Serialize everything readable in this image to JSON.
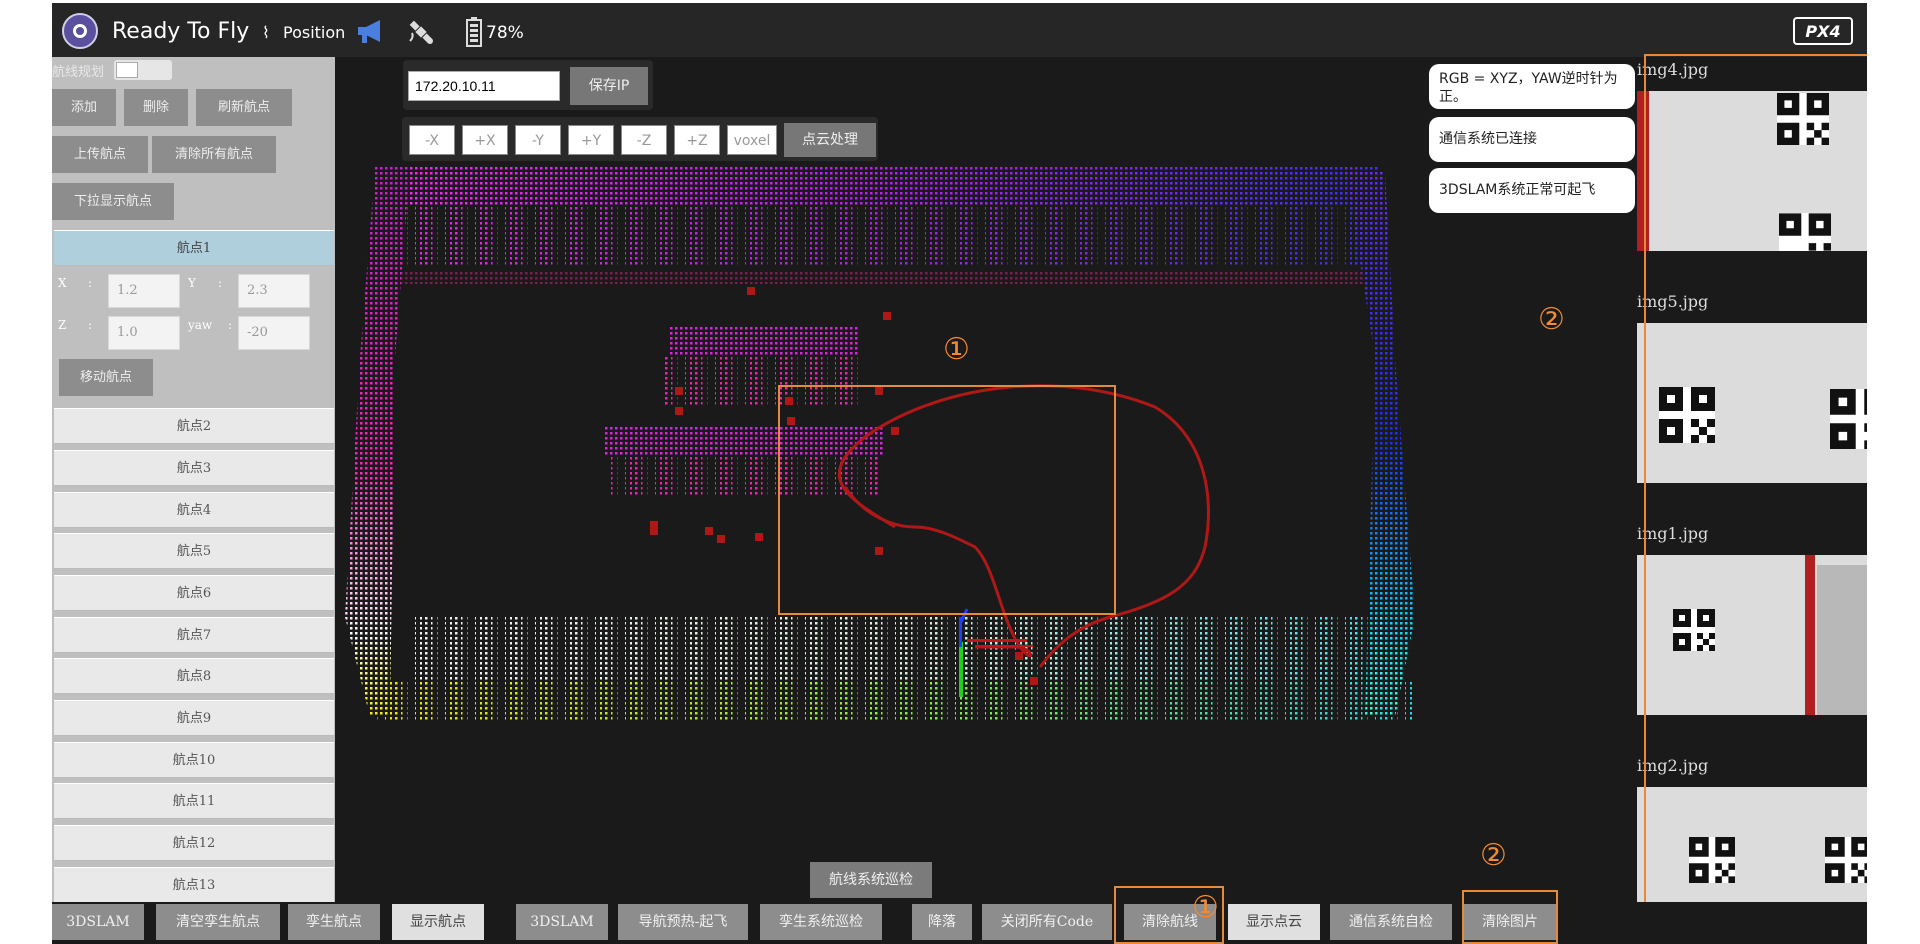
{
  "topbar": {
    "status": "Ready To Fly",
    "mode": "Position",
    "mode_icon": "⌇",
    "battery": "78%",
    "brand": "PX4"
  },
  "left": {
    "toggle_label": "航线规划",
    "buttons": {
      "add": "添加",
      "delete": "删除",
      "refresh": "刷新航点",
      "upload": "上传航点",
      "clear_all": "清除所有航点",
      "pulldown": "下拉显示航点"
    },
    "active_waypoint": "航点1",
    "coords": {
      "x_label": "X",
      "x_value": "1.2",
      "y_label": "Y",
      "y_value": "2.3",
      "z_label": "Z",
      "z_value": "1.0",
      "yaw_label": "yaw",
      "yaw_value": "-20",
      "colon": ":"
    },
    "move_button": "移动航点",
    "waypoints": [
      "航点2",
      "航点3",
      "航点4",
      "航点5",
      "航点6",
      "航点7",
      "航点8",
      "航点9",
      "航点10",
      "航点11",
      "航点12",
      "航点13"
    ]
  },
  "viewer": {
    "ip": "172.20.10.11",
    "save_ip": "保存IP",
    "axis_buttons": [
      "-X",
      "+X",
      "-Y",
      "+Y",
      "-Z",
      "+Z",
      "voxel"
    ],
    "pointcloud_button": "点云处理"
  },
  "notes": {
    "rgb": "RGB = XYZ，YAW逆时针为正。",
    "comm": "通信系统已连接",
    "slam": "3DSLAM系统正常可起飞"
  },
  "images": [
    {
      "name": "img4.jpg"
    },
    {
      "name": "img5.jpg"
    },
    {
      "name": "img1.jpg"
    },
    {
      "name": "img2.jpg"
    }
  ],
  "annotations": {
    "one": "①",
    "two": "②"
  },
  "bottom": {
    "float_button": "航线系统巡检",
    "buttons": [
      "3DSLAM",
      "清空孪生航点",
      "孪生航点",
      "显示航点",
      "3DSLAM",
      "导航预热-起飞",
      "孪生系统巡检",
      "降落",
      "关闭所有Code",
      "清除航线",
      "显示点云",
      "通信系统自检",
      "清除图片"
    ]
  },
  "colors": {
    "accent_orange": "#e58a3a",
    "trajectory_red": "#b01818"
  }
}
